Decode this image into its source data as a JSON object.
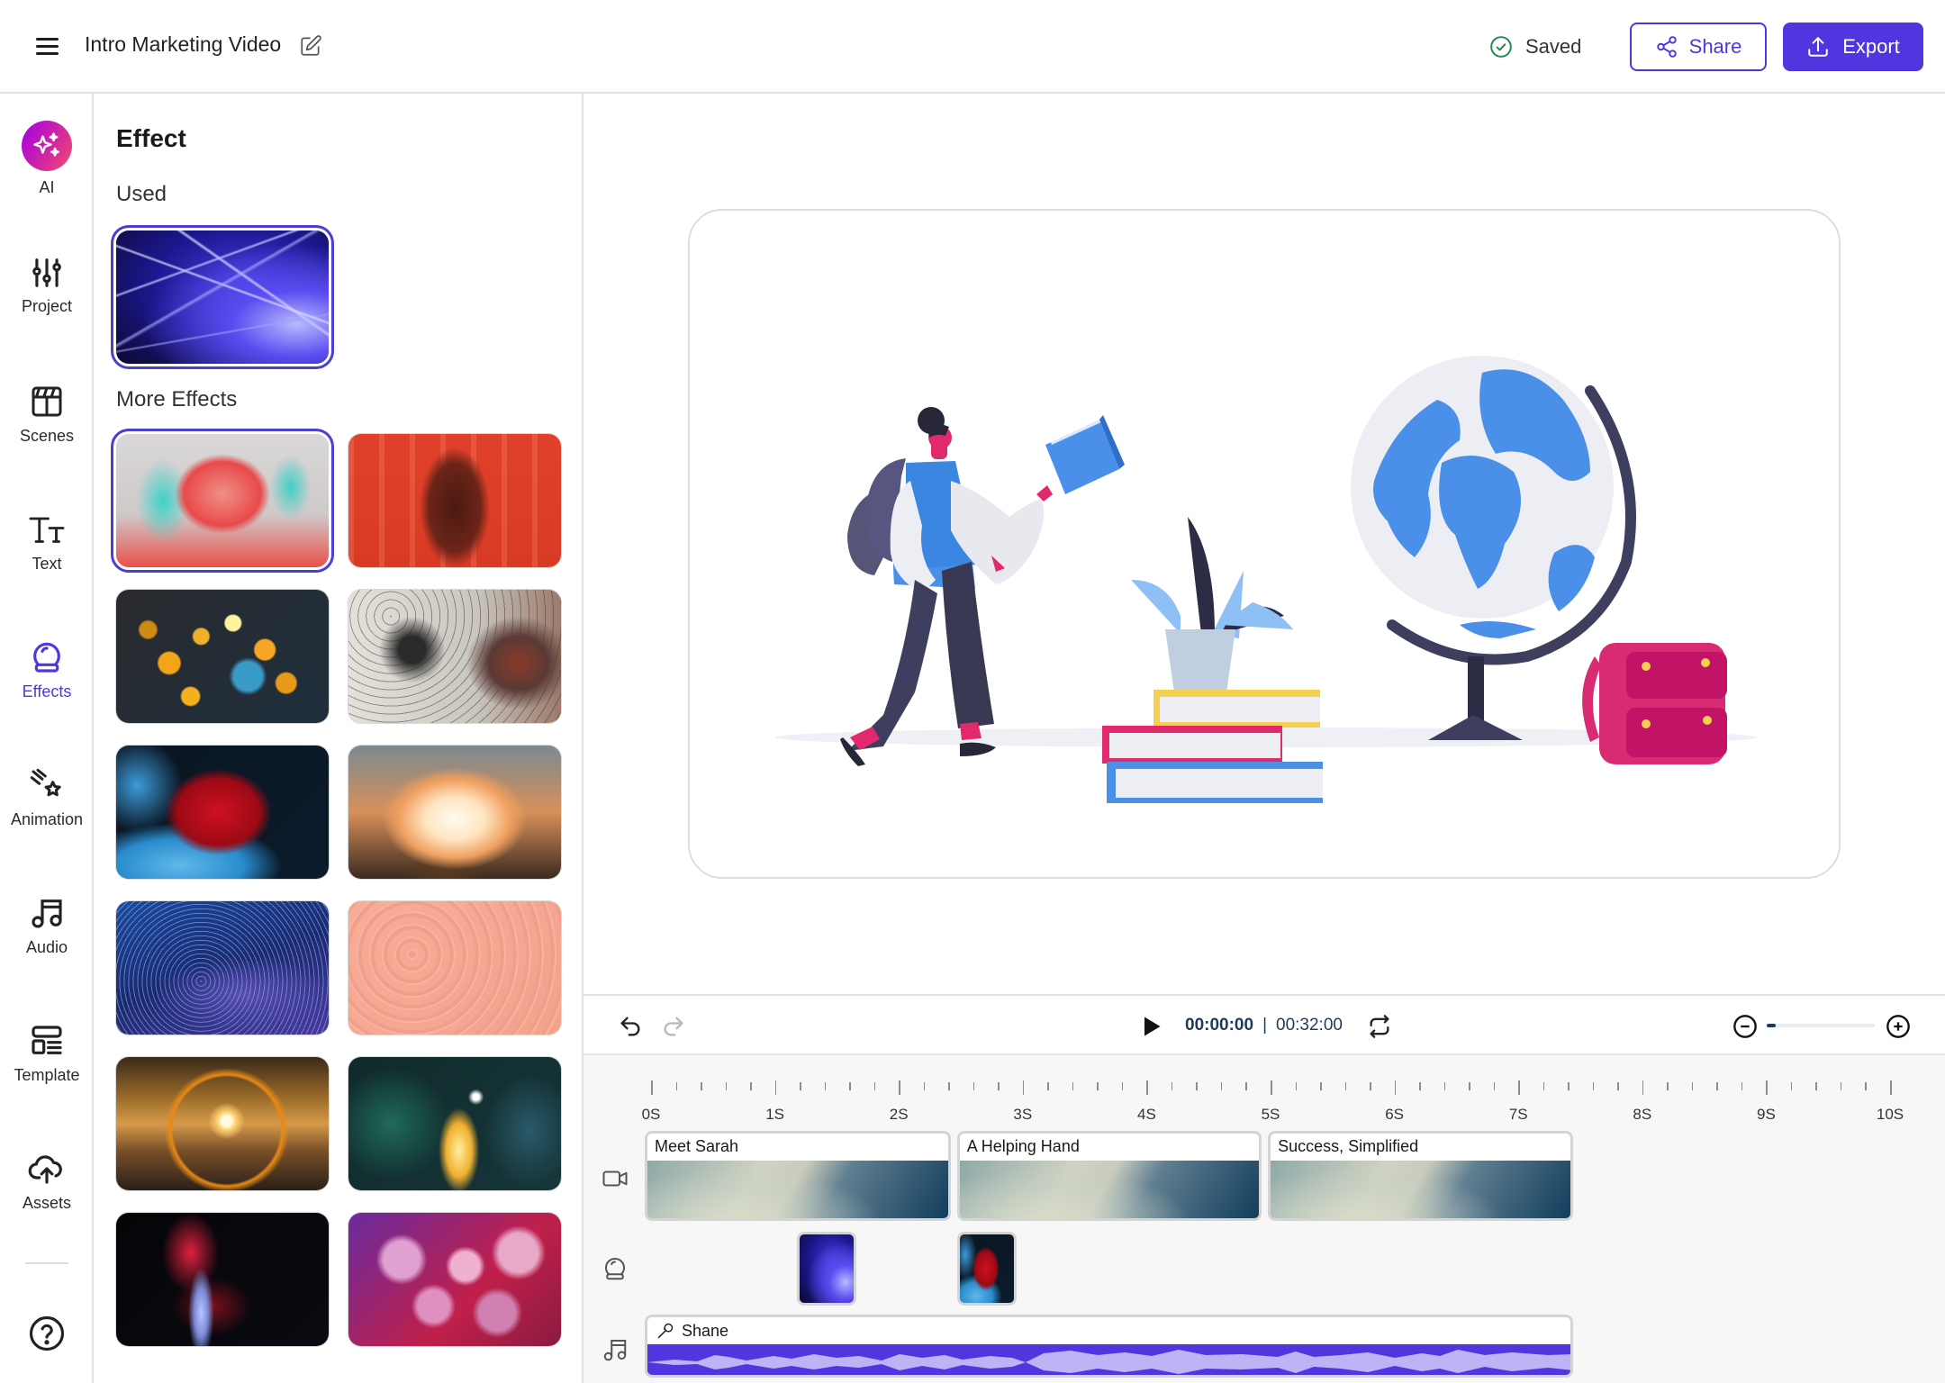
{
  "header": {
    "title": "Intro Marketing Video",
    "status": "Saved",
    "share_label": "Share",
    "export_label": "Export",
    "accent_color": "#5136e0",
    "saved_color": "#1d8a4e"
  },
  "rail": {
    "items": [
      {
        "id": "ai",
        "label": "AI",
        "icon": "sparkles-icon"
      },
      {
        "id": "project",
        "label": "Project",
        "icon": "sliders-icon"
      },
      {
        "id": "scenes",
        "label": "Scenes",
        "icon": "clapperboard-icon"
      },
      {
        "id": "text",
        "label": "Text",
        "icon": "text-icon"
      },
      {
        "id": "effects",
        "label": "Effects",
        "icon": "crystal-ball-icon",
        "active": true
      },
      {
        "id": "animation",
        "label": "Animation",
        "icon": "shooting-star-icon"
      },
      {
        "id": "audio",
        "label": "Audio",
        "icon": "music-note-icon"
      },
      {
        "id": "template",
        "label": "Template",
        "icon": "layout-template-icon"
      },
      {
        "id": "assets",
        "label": "Assets",
        "icon": "cloud-upload-icon"
      }
    ],
    "help_icon": "help-icon"
  },
  "panel": {
    "title": "Effect",
    "used_label": "Used",
    "more_label": "More Effects",
    "used": [
      {
        "name": "blue-light-streaks",
        "selected": true
      }
    ],
    "more": [
      {
        "name": "rgb-split-portrait",
        "selected": true
      },
      {
        "name": "red-text-projection",
        "selected": false
      },
      {
        "name": "golden-bokeh",
        "selected": false
      },
      {
        "name": "rain-drops-glass",
        "selected": false
      },
      {
        "name": "red-ink-blue-smoke",
        "selected": false
      },
      {
        "name": "fiery-explosion",
        "selected": false
      },
      {
        "name": "blue-glitter-wave",
        "selected": false
      },
      {
        "name": "peach-water-droplets",
        "selected": false
      },
      {
        "name": "sun-halo-lens-flare",
        "selected": false
      },
      {
        "name": "sparkler-fire",
        "selected": false
      },
      {
        "name": "red-smoke-swirl",
        "selected": false
      },
      {
        "name": "kaleidoscope-portraits",
        "selected": false
      }
    ]
  },
  "transport": {
    "current_time": "00:00:00",
    "separator": "|",
    "total_time": "00:32:00",
    "zoom_level": 0.08
  },
  "timeline": {
    "ruler_labels": [
      "0S",
      "1S",
      "2S",
      "3S",
      "4S",
      "5S",
      "6S",
      "7S",
      "8S",
      "9S",
      "10S"
    ],
    "scenes": [
      {
        "title": "Meet Sarah",
        "start": 0,
        "end": 2.47
      },
      {
        "title": "A Helping Hand",
        "start": 2.52,
        "end": 4.98
      },
      {
        "title": "Success, Simplified",
        "start": 5.03,
        "end": 7.49
      }
    ],
    "effects": [
      {
        "name": "blue-light-streaks",
        "start": 1.23
      },
      {
        "name": "red-ink-blue-smoke",
        "start": 2.52
      }
    ],
    "audio": {
      "title": "Shane",
      "start": 0,
      "end": 7.49
    }
  }
}
